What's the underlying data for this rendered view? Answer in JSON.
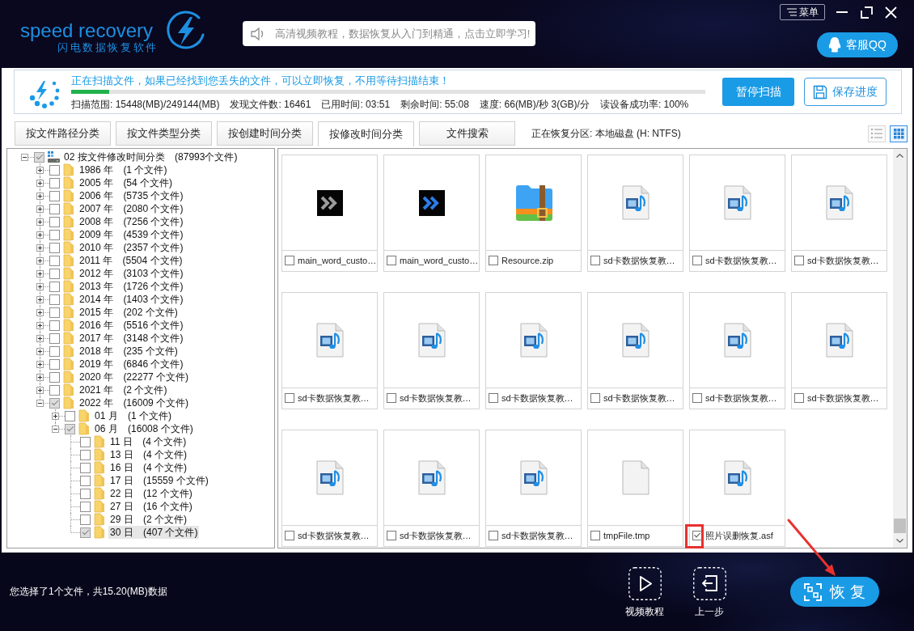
{
  "header": {
    "logo": "speed recovery",
    "subtitle": "闪电数据恢复软件",
    "notice": "高清视频教程，数据恢复从入门到精通，点击立即学习!",
    "menu": "菜单",
    "support": "客服QQ"
  },
  "scan": {
    "message": "正在扫描文件，如果已经找到您丢失的文件，可以立即恢复，不用等待扫描结束！",
    "progress": {
      "level": 0.06
    },
    "stats": [
      "扫描范围: 15448(MB)/249144(MB)",
      "发现文件数: 16461",
      "已用时间: 03:51",
      "剩余时间: 55:08",
      "速度: 66(MB)/秒 3(GB)/分",
      "读设备成功率: 100%"
    ],
    "buttons": [
      {
        "label": "暂停扫描",
        "kind": "primary"
      },
      {
        "label": "保存进度",
        "kind": "save"
      }
    ]
  },
  "tabs": [
    {
      "label": "按文件路径分类",
      "selected": false
    },
    {
      "label": "按文件类型分类",
      "selected": false
    },
    {
      "label": "按创建时间分类",
      "selected": false
    },
    {
      "label": "按修改时间分类",
      "selected": true
    },
    {
      "label": "文件搜索",
      "selected": false
    }
  ],
  "partition": "正在恢复分区: 本地磁盘 (H: NTFS)",
  "view_modes": [
    {
      "kind": "list",
      "selected": false
    },
    {
      "kind": "grid",
      "selected": true
    }
  ],
  "tree": {
    "label": "02 按文件修改时间分类",
    "count": "(87993个文件)",
    "checked": true,
    "selected": false,
    "expanded": true,
    "children": [
      {
        "label": "1986 年",
        "count": "(1 个文件)",
        "checked": false,
        "selected": false,
        "expanded": false
      },
      {
        "label": "2005 年",
        "count": "(54 个文件)",
        "checked": false,
        "selected": false,
        "expanded": false
      },
      {
        "label": "2006 年",
        "count": "(5735 个文件)",
        "checked": false,
        "selected": false,
        "expanded": false
      },
      {
        "label": "2007 年",
        "count": "(2080 个文件)",
        "checked": false,
        "selected": false,
        "expanded": false
      },
      {
        "label": "2008 年",
        "count": "(7256 个文件)",
        "checked": false,
        "selected": false,
        "expanded": false
      },
      {
        "label": "2009 年",
        "count": "(4539 个文件)",
        "checked": false,
        "selected": false,
        "expanded": false
      },
      {
        "label": "2010 年",
        "count": "(2357 个文件)",
        "checked": false,
        "selected": false,
        "expanded": false
      },
      {
        "label": "2011 年",
        "count": "(5504 个文件)",
        "checked": false,
        "selected": false,
        "expanded": false
      },
      {
        "label": "2012 年",
        "count": "(3103 个文件)",
        "checked": false,
        "selected": false,
        "expanded": false
      },
      {
        "label": "2013 年",
        "count": "(1726 个文件)",
        "checked": false,
        "selected": false,
        "expanded": false
      },
      {
        "label": "2014 年",
        "count": "(1403 个文件)",
        "checked": false,
        "selected": false,
        "expanded": false
      },
      {
        "label": "2015 年",
        "count": "(202 个文件)",
        "checked": false,
        "selected": false,
        "expanded": false
      },
      {
        "label": "2016 年",
        "count": "(5516 个文件)",
        "checked": false,
        "selected": false,
        "expanded": false
      },
      {
        "label": "2017 年",
        "count": "(3148 个文件)",
        "checked": false,
        "selected": false,
        "expanded": false
      },
      {
        "label": "2018 年",
        "count": "(235 个文件)",
        "checked": false,
        "selected": false,
        "expanded": false
      },
      {
        "label": "2019 年",
        "count": "(6846 个文件)",
        "checked": false,
        "selected": false,
        "expanded": false
      },
      {
        "label": "2020 年",
        "count": "(22277 个文件)",
        "checked": false,
        "selected": false,
        "expanded": false
      },
      {
        "label": "2021 年",
        "count": "(2 个文件)",
        "checked": false,
        "selected": false,
        "expanded": false
      },
      {
        "label": "2022 年",
        "count": "(16009 个文件)",
        "checked": true,
        "selected": false,
        "expanded": true,
        "children": [
          {
            "label": "01 月",
            "count": "(1 个文件)",
            "checked": false,
            "selected": false,
            "expanded": false
          },
          {
            "label": "06 月",
            "count": "(16008 个文件)",
            "checked": true,
            "selected": false,
            "expanded": true,
            "children": [
              {
                "label": "11 日",
                "count": "(4 个文件)",
                "checked": false,
                "selected": false
              },
              {
                "label": "13 日",
                "count": "(4 个文件)",
                "checked": false,
                "selected": false
              },
              {
                "label": "16 日",
                "count": "(4 个文件)",
                "checked": false,
                "selected": false
              },
              {
                "label": "17 日",
                "count": "(15559 个文件)",
                "checked": false,
                "selected": false
              },
              {
                "label": "22 日",
                "count": "(12 个文件)",
                "checked": false,
                "selected": false
              },
              {
                "label": "27 日",
                "count": "(16 个文件)",
                "checked": false,
                "selected": false
              },
              {
                "label": "29 日",
                "count": "(2 个文件)",
                "checked": false,
                "selected": false
              },
              {
                "label": "30 日",
                "count": "(407 个文件)",
                "checked": true,
                "selected": true
              }
            ]
          }
        ]
      }
    ]
  },
  "files": [
    {
      "name": "main_word_custo…",
      "kind": "program",
      "checked": false
    },
    {
      "name": "main_word_custo…",
      "kind": "launcher",
      "checked": false
    },
    {
      "name": "Resource.zip",
      "kind": "archive",
      "checked": false
    },
    {
      "name": "sd卡数据恢复教…",
      "kind": "video",
      "checked": false
    },
    {
      "name": "sd卡数据恢复教…",
      "kind": "video",
      "checked": false
    },
    {
      "name": "sd卡数据恢复教…",
      "kind": "video",
      "checked": false
    },
    {
      "name": "sd卡数据恢复教…",
      "kind": "video",
      "checked": false
    },
    {
      "name": "sd卡数据恢复教…",
      "kind": "video",
      "checked": false
    },
    {
      "name": "sd卡数据恢复教…",
      "kind": "video",
      "checked": false
    },
    {
      "name": "sd卡数据恢复教…",
      "kind": "video",
      "checked": false
    },
    {
      "name": "sd卡数据恢复教…",
      "kind": "video",
      "checked": false
    },
    {
      "name": "sd卡数据恢复教…",
      "kind": "video",
      "checked": false
    },
    {
      "name": "sd卡数据恢复教…",
      "kind": "video",
      "checked": false
    },
    {
      "name": "sd卡数据恢复教…",
      "kind": "video",
      "checked": false
    },
    {
      "name": "sd卡数据恢复教…",
      "kind": "video",
      "checked": false
    },
    {
      "name": "tmpFile.tmp",
      "kind": "blank",
      "checked": false
    },
    {
      "name": "照片误删恢复.asf",
      "kind": "video",
      "checked": true
    }
  ],
  "status": "您选择了1个文件，共15.20(MB)数据",
  "footer_buttons": [
    {
      "label": "视频教程",
      "kind": "video"
    },
    {
      "label": "上一步",
      "kind": "back"
    }
  ],
  "recover_button": "恢复"
}
